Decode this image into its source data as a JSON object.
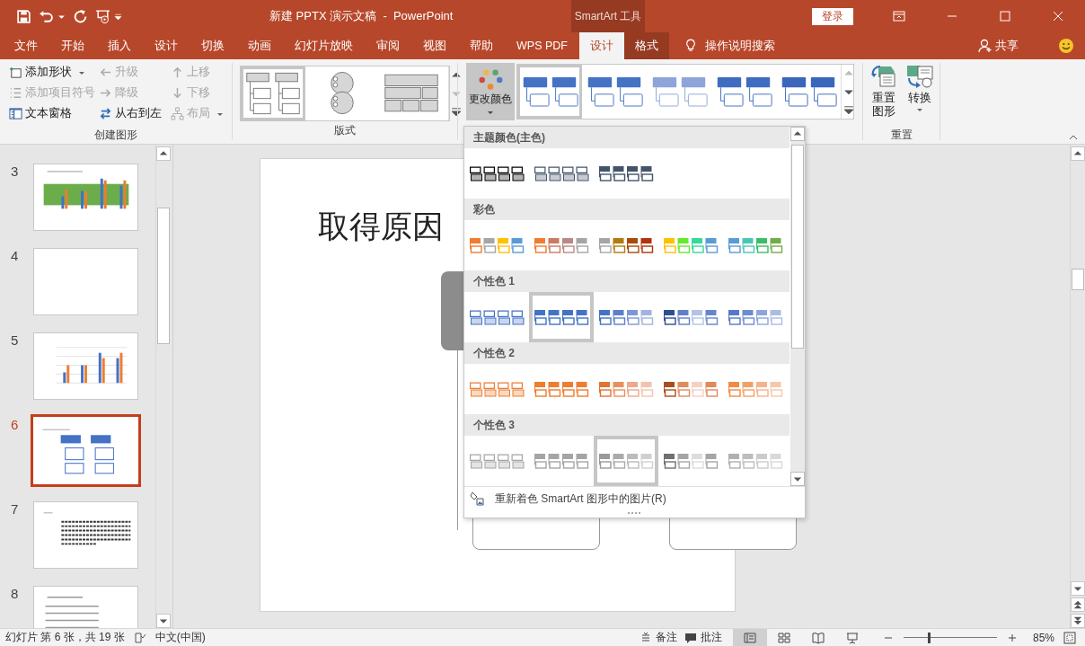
{
  "window": {
    "title": "新建 PPTX 演示文稿  -  PowerPoint",
    "context_header": "SmartArt 工具",
    "sign_in": "登录"
  },
  "tabs": [
    {
      "label": "文件",
      "selected": false,
      "contextual": false
    },
    {
      "label": "开始",
      "selected": false,
      "contextual": false
    },
    {
      "label": "插入",
      "selected": false,
      "contextual": false
    },
    {
      "label": "设计",
      "selected": false,
      "contextual": false
    },
    {
      "label": "切换",
      "selected": false,
      "contextual": false
    },
    {
      "label": "动画",
      "selected": false,
      "contextual": false
    },
    {
      "label": "幻灯片放映",
      "selected": false,
      "contextual": false
    },
    {
      "label": "审阅",
      "selected": false,
      "contextual": false
    },
    {
      "label": "视图",
      "selected": false,
      "contextual": false
    },
    {
      "label": "帮助",
      "selected": false,
      "contextual": false
    },
    {
      "label": "WPS PDF",
      "selected": false,
      "contextual": false
    },
    {
      "label": "设计",
      "selected": true,
      "contextual": true
    },
    {
      "label": "格式",
      "selected": false,
      "contextual": true
    }
  ],
  "tell_me": "操作说明搜索",
  "share": "共享",
  "create_graphic": {
    "label": "创建图形",
    "commands": [
      {
        "kind": "add-shape",
        "label": "添加形状",
        "disabled": false,
        "dropdown": true
      },
      {
        "kind": "add-bullet",
        "label": "添加项目符号",
        "disabled": true,
        "dropdown": false
      },
      {
        "kind": "text-pane",
        "label": "文本窗格",
        "disabled": false,
        "dropdown": false
      },
      {
        "kind": "promote",
        "label": "升级",
        "disabled": true,
        "dropdown": false
      },
      {
        "kind": "demote",
        "label": "降级",
        "disabled": true,
        "dropdown": false
      },
      {
        "kind": "right-to-left",
        "label": "从右到左",
        "disabled": false,
        "dropdown": false
      },
      {
        "kind": "move-up",
        "label": "上移",
        "disabled": true,
        "dropdown": false
      },
      {
        "kind": "move-down",
        "label": "下移",
        "disabled": true,
        "dropdown": false
      },
      {
        "kind": "layout",
        "label": "布局",
        "disabled": true,
        "dropdown": true
      }
    ]
  },
  "layouts": {
    "label": "版式",
    "items": [
      {
        "kind": "hierarchy",
        "selected": true
      },
      {
        "kind": "circles",
        "selected": false
      },
      {
        "kind": "blocks",
        "selected": false
      }
    ]
  },
  "change_colors": {
    "label": "更改颜色",
    "expanded": true
  },
  "styles": [
    {
      "selected": true,
      "color": "#4472c4"
    },
    {
      "selected": false,
      "color": "#4472c4"
    },
    {
      "selected": false,
      "color": "#8ea5d9"
    },
    {
      "selected": false,
      "color": "#3f6cc0"
    },
    {
      "selected": false,
      "color": "#3a66bb"
    }
  ],
  "reset": {
    "label": "重置",
    "commands": [
      {
        "label": "重置图形",
        "dropdown": false
      },
      {
        "label": "转换",
        "dropdown": true
      }
    ]
  },
  "color_menu": {
    "sections": [
      {
        "title": "主题颜色(主色)",
        "options": [
          {
            "kind": "outline",
            "selected": false,
            "colors": [
              {
                "color": "#000000"
              },
              {
                "color": "#000000"
              },
              {
                "color": "#000000"
              },
              {
                "color": "#000000"
              }
            ]
          },
          {
            "kind": "outline",
            "selected": false,
            "colors": [
              {
                "color": "#44546a"
              },
              {
                "color": "#44546a"
              },
              {
                "color": "#44546a"
              },
              {
                "color": "#44546a"
              }
            ]
          },
          {
            "kind": "fill",
            "selected": false,
            "colors": [
              {
                "color": "#44546a"
              },
              {
                "color": "#44546a"
              },
              {
                "color": "#44546a"
              },
              {
                "color": "#44546a"
              }
            ]
          }
        ]
      },
      {
        "title": "彩色",
        "options": [
          {
            "kind": "fill",
            "selected": false,
            "colors": [
              {
                "color": "#ed7d31"
              },
              {
                "color": "#a5a5a5"
              },
              {
                "color": "#ffc000"
              },
              {
                "color": "#5b9bd5"
              }
            ]
          },
          {
            "kind": "fill",
            "selected": false,
            "colors": [
              {
                "color": "#ed7d31"
              },
              {
                "color": "#c97a64"
              },
              {
                "color": "#b78a82"
              },
              {
                "color": "#a5a5a5"
              }
            ]
          },
          {
            "kind": "fill",
            "selected": false,
            "colors": [
              {
                "color": "#a5a5a5"
              },
              {
                "color": "#b07b0e"
              },
              {
                "color": "#a84a0a"
              },
              {
                "color": "#b0330c"
              }
            ]
          },
          {
            "kind": "fill",
            "selected": false,
            "colors": [
              {
                "color": "#ffc000"
              },
              {
                "color": "#66e82c"
              },
              {
                "color": "#36d99b"
              },
              {
                "color": "#5b9bd5"
              }
            ]
          },
          {
            "kind": "fill",
            "selected": false,
            "colors": [
              {
                "color": "#5b9bd5"
              },
              {
                "color": "#4ac7b4"
              },
              {
                "color": "#3dbd68"
              },
              {
                "color": "#70ad47"
              }
            ]
          }
        ]
      },
      {
        "title": "个性色 1",
        "options": [
          {
            "kind": "outline",
            "selected": false,
            "colors": [
              {
                "color": "#4472c4"
              },
              {
                "color": "#4472c4"
              },
              {
                "color": "#4472c4"
              },
              {
                "color": "#4472c4"
              }
            ]
          },
          {
            "kind": "fill",
            "selected": true,
            "colors": [
              {
                "color": "#4472c4"
              },
              {
                "color": "#4472c4"
              },
              {
                "color": "#4472c4"
              },
              {
                "color": "#4472c4"
              }
            ]
          },
          {
            "kind": "fill",
            "selected": false,
            "colors": [
              {
                "color": "#4472c4"
              },
              {
                "color": "#5b7fcb"
              },
              {
                "color": "#7e97d4"
              },
              {
                "color": "#a3b3df"
              }
            ]
          },
          {
            "kind": "fill",
            "selected": false,
            "colors": [
              {
                "color": "#2f4f8f"
              },
              {
                "color": "#5f7fc8"
              },
              {
                "color": "#b4c2e4"
              },
              {
                "color": "#6685cc"
              }
            ]
          },
          {
            "kind": "fill",
            "selected": false,
            "colors": [
              {
                "color": "#5479c9"
              },
              {
                "color": "#6d8dd1"
              },
              {
                "color": "#8da6da"
              },
              {
                "color": "#a9bde3"
              }
            ]
          }
        ]
      },
      {
        "title": "个性色 2",
        "options": [
          {
            "kind": "outline",
            "selected": false,
            "colors": [
              {
                "color": "#ed7d31"
              },
              {
                "color": "#ed7d31"
              },
              {
                "color": "#ed7d31"
              },
              {
                "color": "#ed7d31"
              }
            ]
          },
          {
            "kind": "fill",
            "selected": false,
            "colors": [
              {
                "color": "#ed7d31"
              },
              {
                "color": "#ed7d31"
              },
              {
                "color": "#ed7d31"
              },
              {
                "color": "#ed7d31"
              }
            ]
          },
          {
            "kind": "fill",
            "selected": false,
            "colors": [
              {
                "color": "#e07432"
              },
              {
                "color": "#e8905e"
              },
              {
                "color": "#eda98a"
              },
              {
                "color": "#f2c3ae"
              }
            ]
          },
          {
            "kind": "fill",
            "selected": false,
            "colors": [
              {
                "color": "#a94f1c"
              },
              {
                "color": "#e08a5d"
              },
              {
                "color": "#f6d0c1"
              },
              {
                "color": "#e08a5d"
              }
            ]
          },
          {
            "kind": "fill",
            "selected": false,
            "colors": [
              {
                "color": "#f08b45"
              },
              {
                "color": "#f2a068"
              },
              {
                "color": "#f4b48b"
              },
              {
                "color": "#f5c8ab"
              }
            ]
          }
        ]
      },
      {
        "title": "个性色 3",
        "options": [
          {
            "kind": "outline",
            "selected": false,
            "colors": [
              {
                "color": "#a5a5a5"
              },
              {
                "color": "#a5a5a5"
              },
              {
                "color": "#a5a5a5"
              },
              {
                "color": "#a5a5a5"
              }
            ]
          },
          {
            "kind": "fill",
            "selected": false,
            "colors": [
              {
                "color": "#a5a5a5"
              },
              {
                "color": "#a5a5a5"
              },
              {
                "color": "#a5a5a5"
              },
              {
                "color": "#a5a5a5"
              }
            ]
          },
          {
            "kind": "fill",
            "selected": true,
            "colors": [
              {
                "color": "#9a9a9a"
              },
              {
                "color": "#aaaaaa"
              },
              {
                "color": "#bcbcbc"
              },
              {
                "color": "#d0d0d0"
              }
            ]
          },
          {
            "kind": "fill",
            "selected": false,
            "colors": [
              {
                "color": "#707070"
              },
              {
                "color": "#a5a5a5"
              },
              {
                "color": "#dddddd"
              },
              {
                "color": "#a5a5a5"
              }
            ]
          },
          {
            "kind": "fill",
            "selected": false,
            "colors": [
              {
                "color": "#b0b0b0"
              },
              {
                "color": "#bdbdbd"
              },
              {
                "color": "#cbcbcb"
              },
              {
                "color": "#d9d9d9"
              }
            ]
          }
        ]
      }
    ],
    "footer": "重新着色 SmartArt 图形中的图片(R)"
  },
  "slides": [
    {
      "number": "3",
      "selected": false,
      "kind": "banner-chart"
    },
    {
      "number": "4",
      "selected": false,
      "kind": "blank"
    },
    {
      "number": "5",
      "selected": false,
      "kind": "chart"
    },
    {
      "number": "6",
      "selected": true,
      "kind": "smartart"
    },
    {
      "number": "7",
      "selected": false,
      "kind": "text"
    },
    {
      "number": "8",
      "selected": false,
      "kind": "list"
    }
  ],
  "slide": {
    "title": "取得原因"
  },
  "status_bar": {
    "slide_info": "幻灯片 第 6 张，共 19 张",
    "language": "中文(中国)",
    "notes": "备注",
    "comments": "批注",
    "views": [
      {
        "kind": "normal",
        "selected": true
      },
      {
        "kind": "sorter",
        "selected": false
      },
      {
        "kind": "reading",
        "selected": false
      },
      {
        "kind": "slideshow",
        "selected": false
      }
    ],
    "zoom": {
      "level": 0.26,
      "reading": "85%"
    }
  }
}
